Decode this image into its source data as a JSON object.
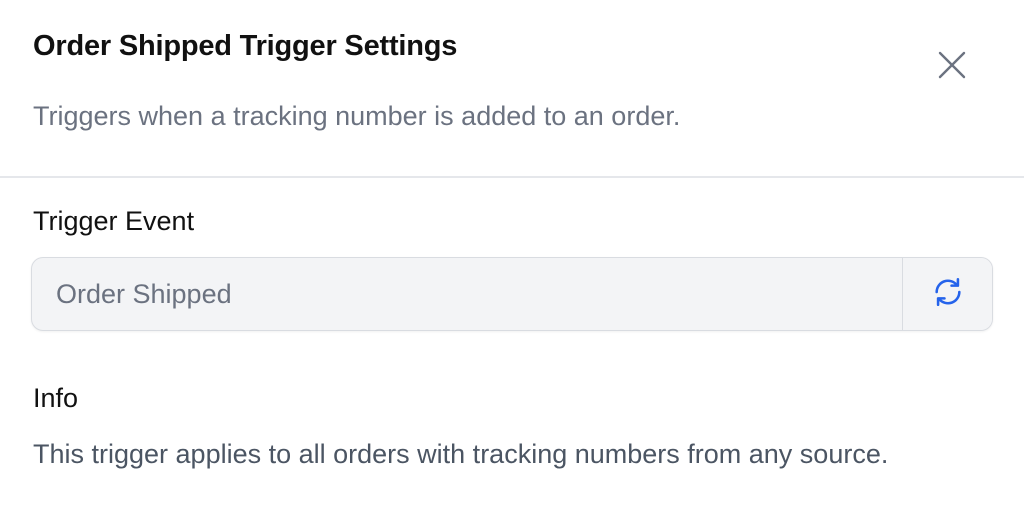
{
  "header": {
    "title": "Order Shipped Trigger Settings",
    "subtitle": "Triggers when a tracking number is added to an order.",
    "close_icon": "close-icon"
  },
  "trigger_event": {
    "label": "Trigger Event",
    "value": "Order Shipped",
    "refresh_icon": "refresh-icon",
    "accent_color": "#2563eb"
  },
  "info": {
    "heading": "Info",
    "text": "This trigger applies to all orders with tracking numbers from any source."
  }
}
